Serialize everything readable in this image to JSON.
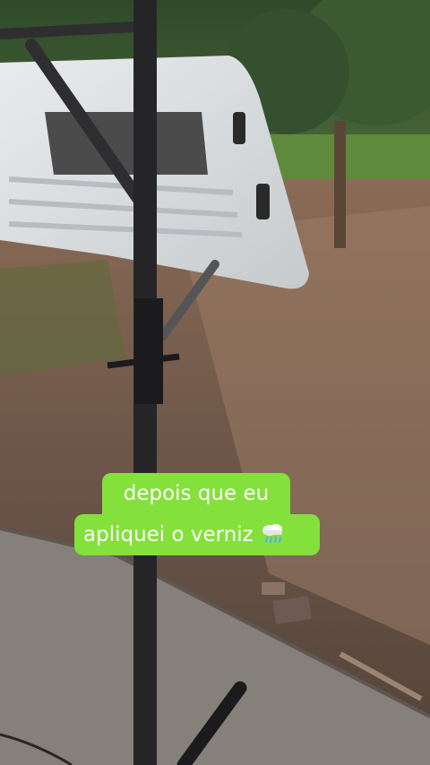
{
  "caption": {
    "line1": "depois que eu",
    "line2": "apliquei o verniz",
    "emoji_icon": "rain-cloud-icon"
  },
  "colors": {
    "caption_bg": "#84e03a",
    "caption_text": "#ffffff"
  }
}
